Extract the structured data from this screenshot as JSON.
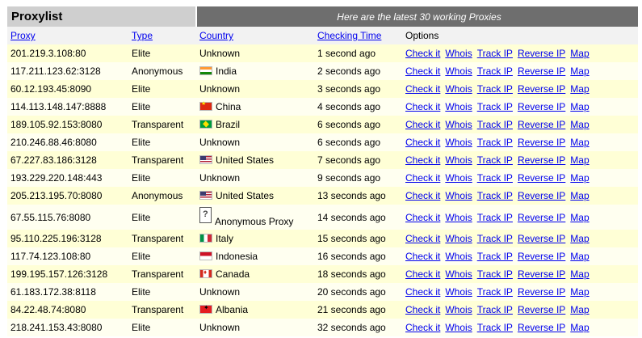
{
  "title": "Proxylist",
  "banner": "Here are the latest 30 working Proxies",
  "columns": {
    "proxy": "Proxy",
    "type": "Type",
    "country": "Country",
    "checking_time": "Checking Time",
    "options": "Options"
  },
  "option_links": {
    "check": "Check it",
    "whois": "Whois",
    "track": "Track IP",
    "reverse": "Reverse IP",
    "map": "Map"
  },
  "rows": [
    {
      "proxy": "201.219.3.108:80",
      "type": "Elite",
      "country": "Unknown",
      "flag": "",
      "time": "1 second ago"
    },
    {
      "proxy": "117.211.123.62:3128",
      "type": "Anonymous",
      "country": "India",
      "flag": "india-flag-icon",
      "time": "2 seconds ago"
    },
    {
      "proxy": "60.12.193.45:8090",
      "type": "Elite",
      "country": "Unknown",
      "flag": "",
      "time": "3 seconds ago"
    },
    {
      "proxy": "114.113.148.147:8888",
      "type": "Elite",
      "country": "China",
      "flag": "china-flag-icon",
      "time": "4 seconds ago"
    },
    {
      "proxy": "189.105.92.153:8080",
      "type": "Transparent",
      "country": "Brazil",
      "flag": "brazil-flag-icon",
      "time": "6 seconds ago"
    },
    {
      "proxy": "210.246.88.46:8080",
      "type": "Elite",
      "country": "Unknown",
      "flag": "",
      "time": "6 seconds ago"
    },
    {
      "proxy": "67.227.83.186:3128",
      "type": "Transparent",
      "country": "United States",
      "flag": "us-flag-icon",
      "time": "7 seconds ago"
    },
    {
      "proxy": "193.229.220.148:443",
      "type": "Elite",
      "country": "Unknown",
      "flag": "",
      "time": "9 seconds ago"
    },
    {
      "proxy": "205.213.195.70:8080",
      "type": "Anonymous",
      "country": "United States",
      "flag": "us-flag-icon",
      "time": "13 seconds ago"
    },
    {
      "proxy": "67.55.115.76:8080",
      "type": "Elite",
      "country": "Anonymous Proxy",
      "flag": "anonymous-proxy-icon",
      "time": "14 seconds ago"
    },
    {
      "proxy": "95.110.225.196:3128",
      "type": "Transparent",
      "country": "Italy",
      "flag": "italy-flag-icon",
      "time": "15 seconds ago"
    },
    {
      "proxy": "117.74.123.108:80",
      "type": "Elite",
      "country": "Indonesia",
      "flag": "indonesia-flag-icon",
      "time": "16 seconds ago"
    },
    {
      "proxy": "199.195.157.126:3128",
      "type": "Transparent",
      "country": "Canada",
      "flag": "canada-flag-icon",
      "time": "18 seconds ago"
    },
    {
      "proxy": "61.183.172.38:8118",
      "type": "Elite",
      "country": "Unknown",
      "flag": "",
      "time": "20 seconds ago"
    },
    {
      "proxy": "84.22.48.74:8080",
      "type": "Transparent",
      "country": "Albania",
      "flag": "albania-flag-icon",
      "time": "21 seconds ago"
    },
    {
      "proxy": "218.241.153.43:8080",
      "type": "Elite",
      "country": "Unknown",
      "flag": "",
      "time": "32 seconds ago"
    }
  ],
  "colors": {
    "row_odd": "#ffffd6",
    "row_even": "#fffff0",
    "banner_bg": "#6e6e6e",
    "title_bg": "#cfcfcf",
    "link": "#0000ee"
  }
}
